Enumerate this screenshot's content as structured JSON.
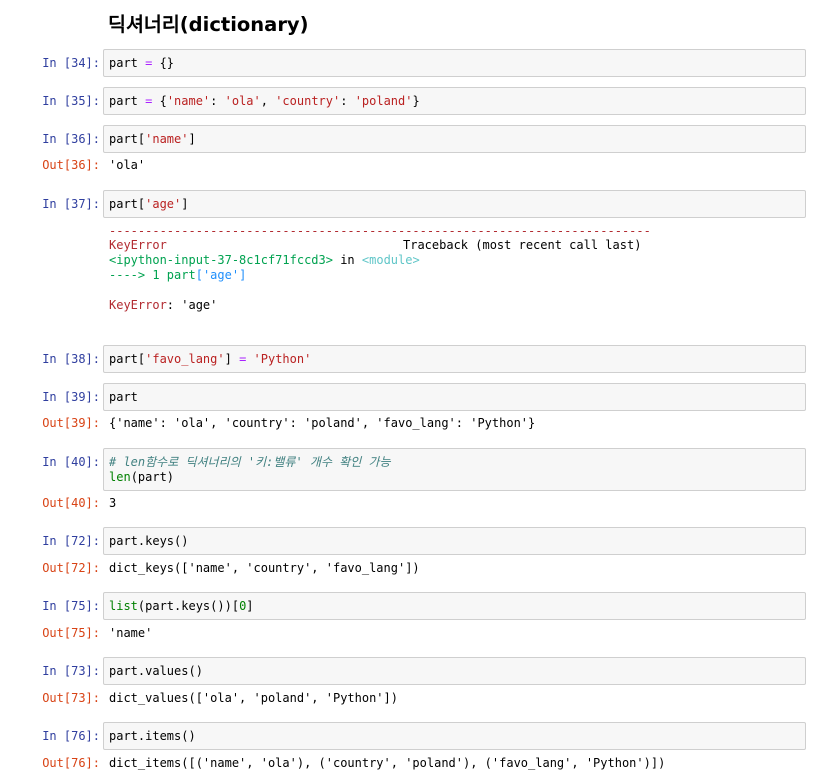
{
  "heading": "딕셔너리(dictionary)",
  "cells": {
    "c34": {
      "in_prompt": "In [34]:"
    },
    "c35": {
      "in_prompt": "In [35]:"
    },
    "c36": {
      "in_prompt": "In [36]:",
      "out_prompt": "Out[36]:",
      "output": "'ola'"
    },
    "c37": {
      "in_prompt": "In [37]:",
      "error": {
        "dashes": "---------------------------------------------------------------------------",
        "name": "KeyError",
        "header_right": "Traceback (most recent call last)",
        "input_ref": "<ipython-input-37-8c1cf71fccd3>",
        "in_word": "in",
        "module": "<module>",
        "arrow_line": "----> 1 part",
        "message": ": 'age'"
      }
    },
    "c38": {
      "in_prompt": "In [38]:"
    },
    "c39": {
      "in_prompt": "In [39]:",
      "out_prompt": "Out[39]:",
      "output": "{'name': 'ola', 'country': 'poland', 'favo_lang': 'Python'}"
    },
    "c40": {
      "in_prompt": "In [40]:",
      "out_prompt": "Out[40]:",
      "output": "3"
    },
    "c72": {
      "in_prompt": "In [72]:",
      "out_prompt": "Out[72]:",
      "output": "dict_keys(['name', 'country', 'favo_lang'])"
    },
    "c75": {
      "in_prompt": "In [75]:",
      "out_prompt": "Out[75]:",
      "output": "'name'"
    },
    "c73": {
      "in_prompt": "In [73]:",
      "out_prompt": "Out[73]:",
      "output": "dict_values(['ola', 'poland', 'Python'])"
    },
    "c76": {
      "in_prompt": "In [76]:",
      "out_prompt": "Out[76]:",
      "output": "dict_items([('name', 'ola'), ('country', 'poland'), ('favo_lang', 'Python')])"
    }
  },
  "code": {
    "c34": {
      "a": "part ",
      "b": "=",
      "c": " {}"
    },
    "c35": {
      "a": "part ",
      "b": "=",
      "c": " {",
      "d": "'name'",
      "e": ": ",
      "f": "'ola'",
      "g": ", ",
      "h": "'country'",
      "i": ": ",
      "j": "'poland'",
      "k": "}"
    },
    "c36": {
      "a": "part[",
      "b": "'name'",
      "c": "]"
    },
    "c37": {
      "a": "part[",
      "b": "'age'",
      "c": "]"
    },
    "c38": {
      "a": "part[",
      "b": "'favo_lang'",
      "c": "] ",
      "d": "=",
      "e": " ",
      "f": "'Python'"
    },
    "c39": {
      "a": "part"
    },
    "c40": {
      "comment": "# len함수로 딕셔너리의 '키:밸류' 개수 확인 가능",
      "fn": "len",
      "rest": "(part)"
    },
    "c72": {
      "a": "part.keys()"
    },
    "c75": {
      "fn": "list",
      "a": "(part.keys())[",
      "n": "0",
      "b": "]"
    },
    "c73": {
      "a": "part.values()"
    },
    "c76": {
      "a": "part.items()"
    }
  },
  "traceback_code": {
    "open": "[",
    "key": "'age'",
    "close": "]"
  },
  "colors": {
    "in_prompt": "#303f9f",
    "out_prompt": "#d84315",
    "cell_bg": "#f7f7f7",
    "string": "#ba2121"
  }
}
